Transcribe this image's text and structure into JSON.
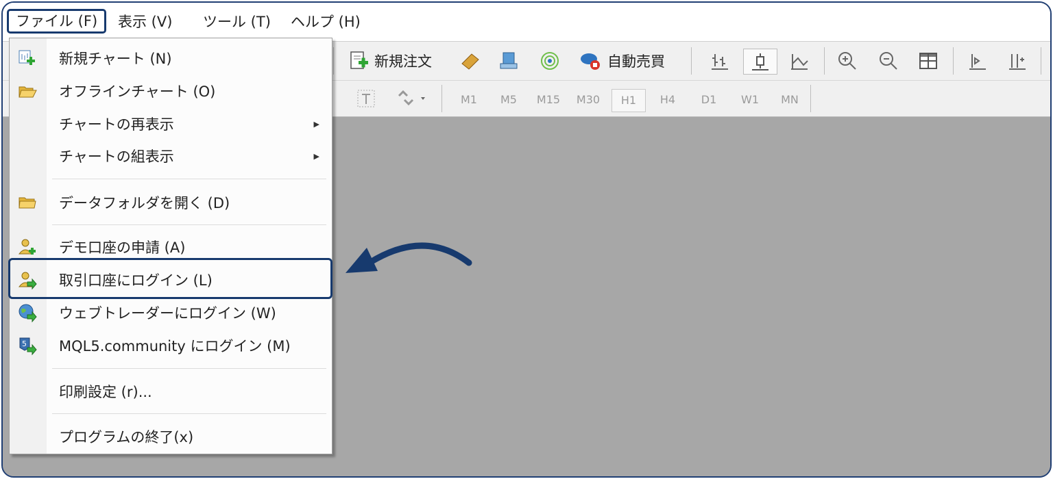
{
  "menubar": {
    "items": [
      "ファイル (F)",
      "表示 (V)",
      "ツール (T)",
      "ヘルプ (H)"
    ]
  },
  "toolbar": {
    "new_order": "新規注文",
    "auto_trade": "自動売買"
  },
  "timeframes": [
    "M1",
    "M5",
    "M15",
    "M30",
    "H1",
    "H4",
    "D1",
    "W1",
    "MN"
  ],
  "selected_timeframe": "H1",
  "file_menu": {
    "new_chart": "新規チャート (N)",
    "offline_chart": "オフラインチャート (O)",
    "redisplay_chart": "チャートの再表示",
    "chart_set": "チャートの組表示",
    "open_data_folder": "データフォルダを開く (D)",
    "demo_account": "デモ口座の申請 (A)",
    "login_trade": "取引口座にログイン (L)",
    "login_webtrader": "ウェブトレーダーにログイン (W)",
    "login_mql5": "MQL5.community にログイン (M)",
    "print_setup": "印刷設定 (r)...",
    "exit": "プログラムの終了(x)"
  },
  "colors": {
    "highlight_border": "#173a6e",
    "chart_area": "#a7a7a7"
  }
}
